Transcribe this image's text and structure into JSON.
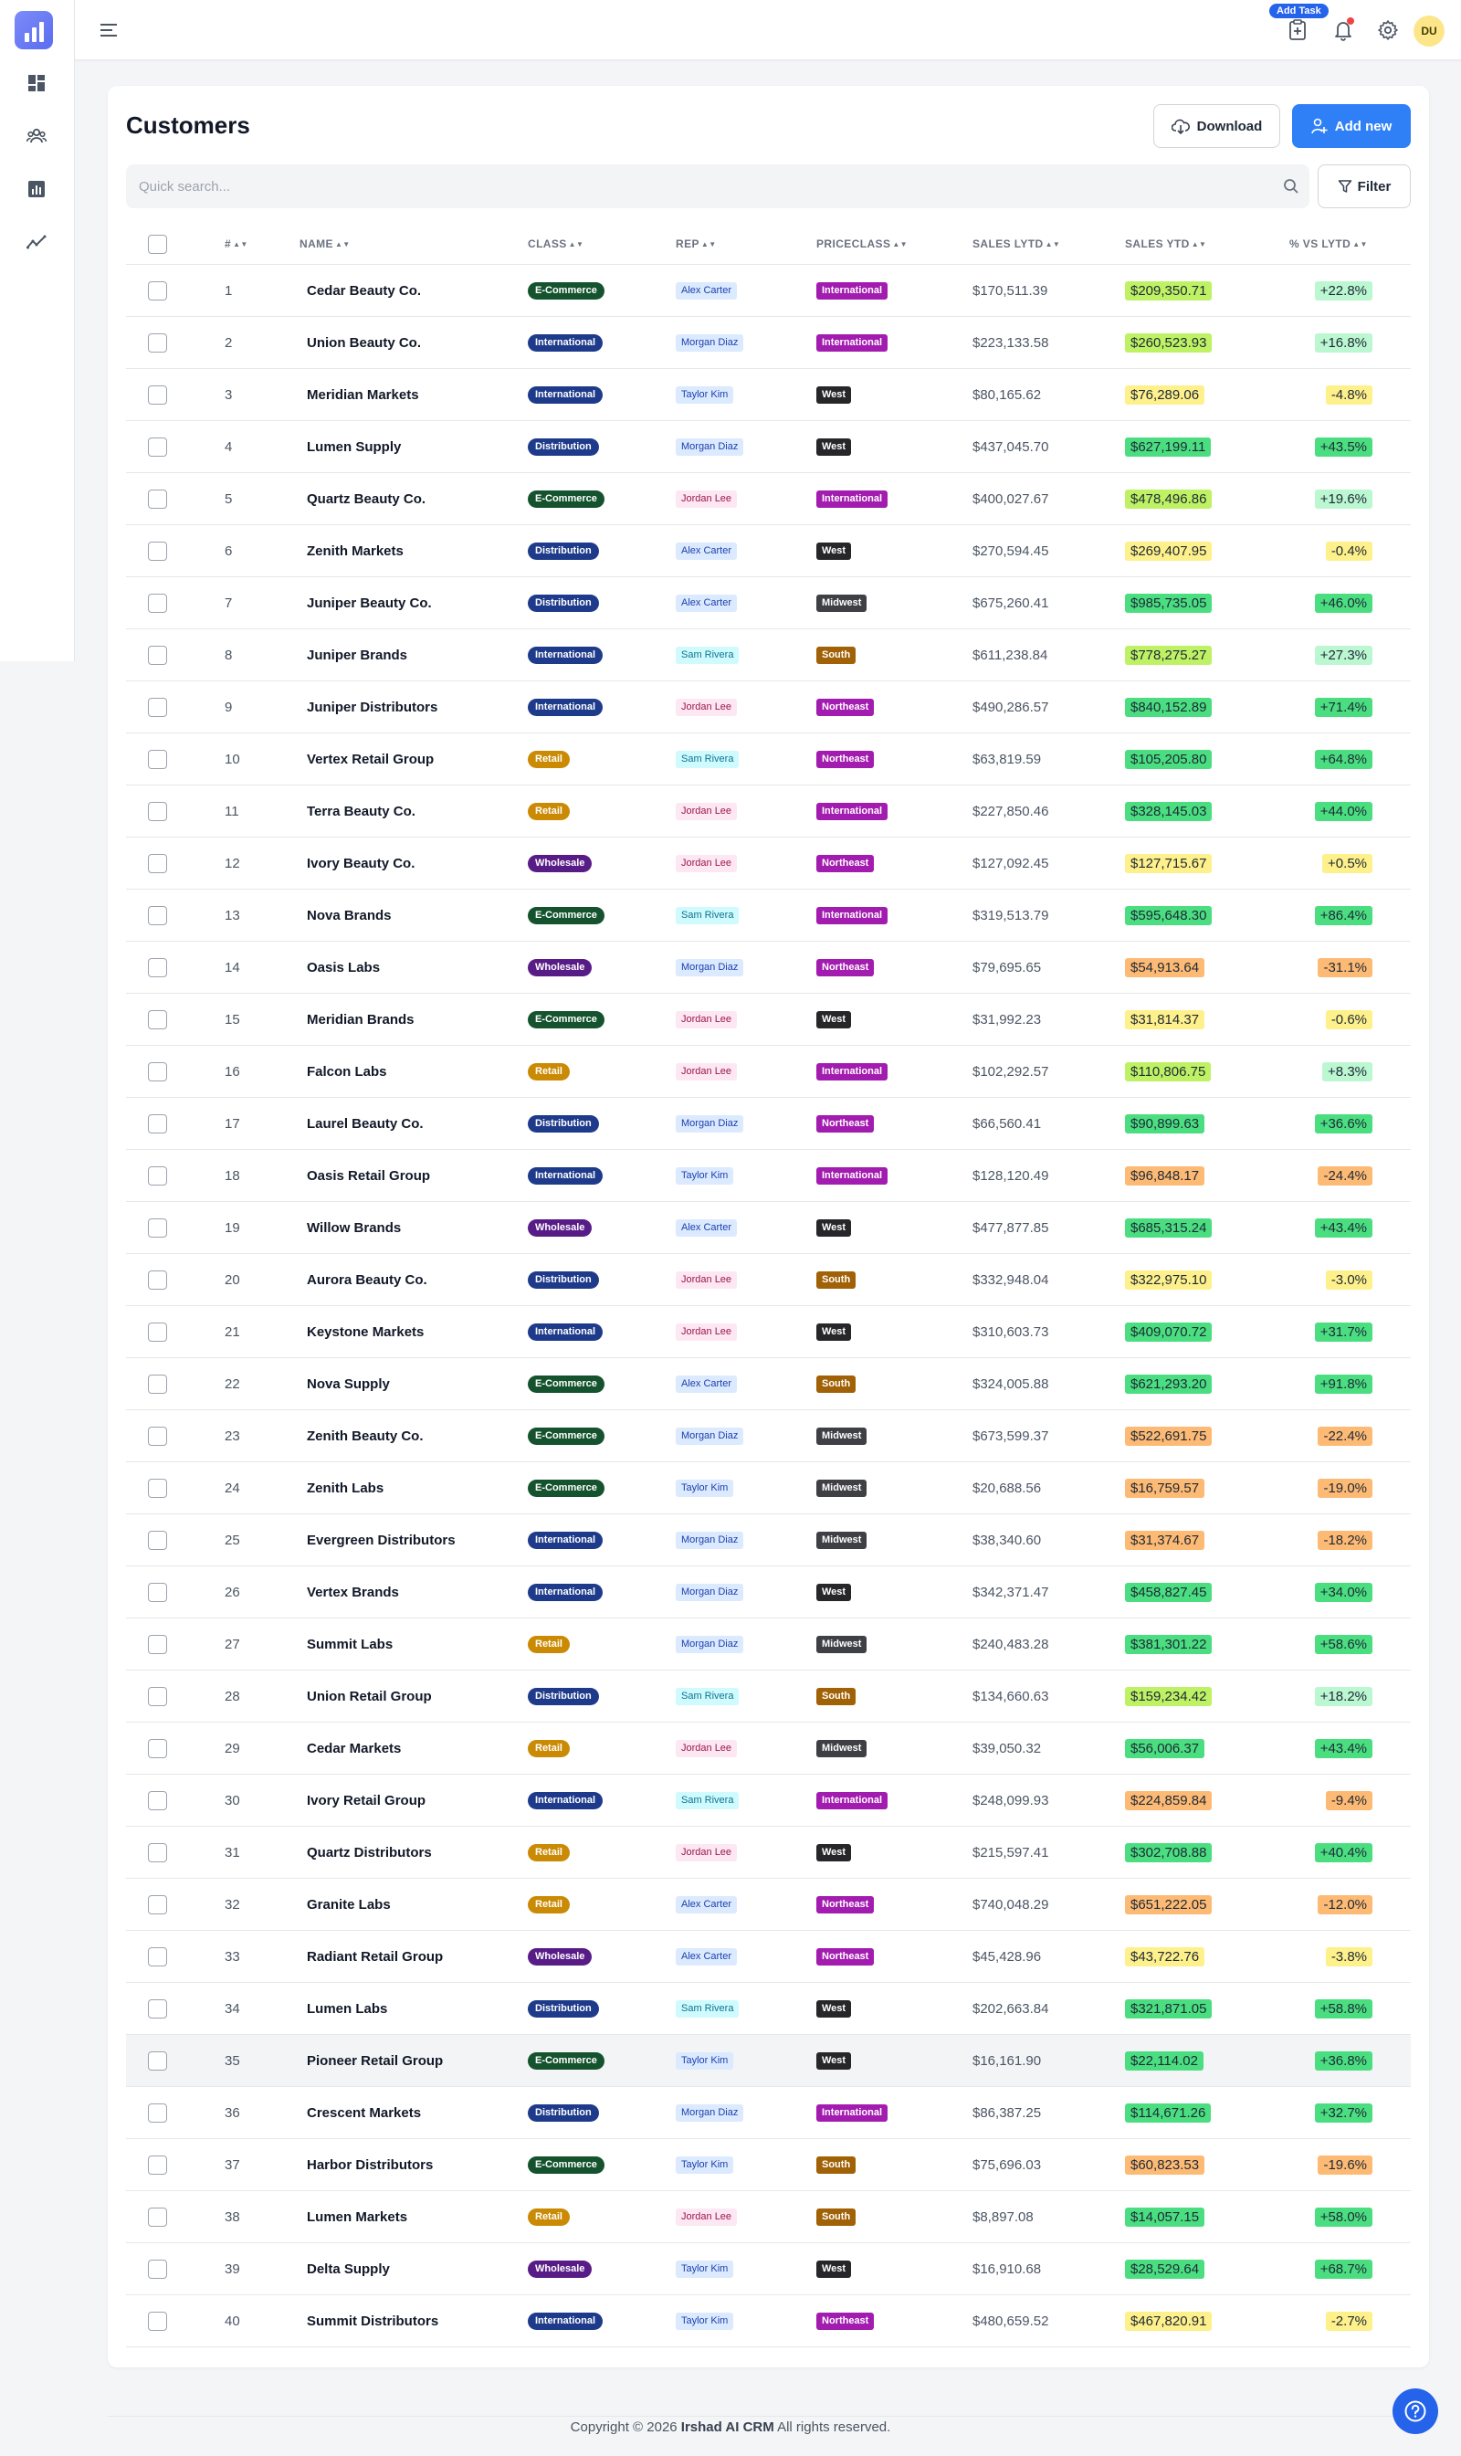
{
  "app": {
    "copyright_prefix": "Copyright © 2026",
    "brand": "Irshad AI CRM",
    "copyright_suffix": "All rights reserved."
  },
  "header": {
    "add_task_label": "Add Task",
    "avatar_initials": "DU"
  },
  "page": {
    "title": "Customers"
  },
  "toolbar": {
    "download_label": "Download",
    "add_new_label": "Add new",
    "filter_label": "Filter"
  },
  "search": {
    "placeholder": "Quick search..."
  },
  "table": {
    "columns": [
      "#",
      "NAME",
      "CLASS",
      "REP",
      "PRICECLASS",
      "SALES LYTD",
      "SALES YTD",
      "% VS LYTD"
    ],
    "highlighted_row": 35,
    "rows": [
      [
        "1",
        "Cedar Beauty Co.",
        "E-Commerce",
        "Alex Carter",
        "International",
        "$170,511.39",
        "$209,350.71",
        "+22.8%"
      ],
      [
        "2",
        "Union Beauty Co.",
        "International",
        "Morgan Diaz",
        "International",
        "$223,133.58",
        "$260,523.93",
        "+16.8%"
      ],
      [
        "3",
        "Meridian Markets",
        "International",
        "Taylor Kim",
        "West",
        "$80,165.62",
        "$76,289.06",
        "-4.8%"
      ],
      [
        "4",
        "Lumen Supply",
        "Distribution",
        "Morgan Diaz",
        "West",
        "$437,045.70",
        "$627,199.11",
        "+43.5%"
      ],
      [
        "5",
        "Quartz Beauty Co.",
        "E-Commerce",
        "Jordan Lee",
        "International",
        "$400,027.67",
        "$478,496.86",
        "+19.6%"
      ],
      [
        "6",
        "Zenith Markets",
        "Distribution",
        "Alex Carter",
        "West",
        "$270,594.45",
        "$269,407.95",
        "-0.4%"
      ],
      [
        "7",
        "Juniper Beauty Co.",
        "Distribution",
        "Alex Carter",
        "Midwest",
        "$675,260.41",
        "$985,735.05",
        "+46.0%"
      ],
      [
        "8",
        "Juniper Brands",
        "International",
        "Sam Rivera",
        "South",
        "$611,238.84",
        "$778,275.27",
        "+27.3%"
      ],
      [
        "9",
        "Juniper Distributors",
        "International",
        "Jordan Lee",
        "Northeast",
        "$490,286.57",
        "$840,152.89",
        "+71.4%"
      ],
      [
        "10",
        "Vertex Retail Group",
        "Retail",
        "Sam Rivera",
        "Northeast",
        "$63,819.59",
        "$105,205.80",
        "+64.8%"
      ],
      [
        "11",
        "Terra Beauty Co.",
        "Retail",
        "Jordan Lee",
        "International",
        "$227,850.46",
        "$328,145.03",
        "+44.0%"
      ],
      [
        "12",
        "Ivory Beauty Co.",
        "Wholesale",
        "Jordan Lee",
        "Northeast",
        "$127,092.45",
        "$127,715.67",
        "+0.5%"
      ],
      [
        "13",
        "Nova Brands",
        "E-Commerce",
        "Sam Rivera",
        "International",
        "$319,513.79",
        "$595,648.30",
        "+86.4%"
      ],
      [
        "14",
        "Oasis Labs",
        "Wholesale",
        "Morgan Diaz",
        "Northeast",
        "$79,695.65",
        "$54,913.64",
        "-31.1%"
      ],
      [
        "15",
        "Meridian Brands",
        "E-Commerce",
        "Jordan Lee",
        "West",
        "$31,992.23",
        "$31,814.37",
        "-0.6%"
      ],
      [
        "16",
        "Falcon Labs",
        "Retail",
        "Jordan Lee",
        "International",
        "$102,292.57",
        "$110,806.75",
        "+8.3%"
      ],
      [
        "17",
        "Laurel Beauty Co.",
        "Distribution",
        "Morgan Diaz",
        "Northeast",
        "$66,560.41",
        "$90,899.63",
        "+36.6%"
      ],
      [
        "18",
        "Oasis Retail Group",
        "International",
        "Taylor Kim",
        "International",
        "$128,120.49",
        "$96,848.17",
        "-24.4%"
      ],
      [
        "19",
        "Willow Brands",
        "Wholesale",
        "Alex Carter",
        "West",
        "$477,877.85",
        "$685,315.24",
        "+43.4%"
      ],
      [
        "20",
        "Aurora Beauty Co.",
        "Distribution",
        "Jordan Lee",
        "South",
        "$332,948.04",
        "$322,975.10",
        "-3.0%"
      ],
      [
        "21",
        "Keystone Markets",
        "International",
        "Jordan Lee",
        "West",
        "$310,603.73",
        "$409,070.72",
        "+31.7%"
      ],
      [
        "22",
        "Nova Supply",
        "E-Commerce",
        "Alex Carter",
        "South",
        "$324,005.88",
        "$621,293.20",
        "+91.8%"
      ],
      [
        "23",
        "Zenith Beauty Co.",
        "E-Commerce",
        "Morgan Diaz",
        "Midwest",
        "$673,599.37",
        "$522,691.75",
        "-22.4%"
      ],
      [
        "24",
        "Zenith Labs",
        "E-Commerce",
        "Taylor Kim",
        "Midwest",
        "$20,688.56",
        "$16,759.57",
        "-19.0%"
      ],
      [
        "25",
        "Evergreen Distributors",
        "International",
        "Morgan Diaz",
        "Midwest",
        "$38,340.60",
        "$31,374.67",
        "-18.2%"
      ],
      [
        "26",
        "Vertex Brands",
        "International",
        "Morgan Diaz",
        "West",
        "$342,371.47",
        "$458,827.45",
        "+34.0%"
      ],
      [
        "27",
        "Summit Labs",
        "Retail",
        "Morgan Diaz",
        "Midwest",
        "$240,483.28",
        "$381,301.22",
        "+58.6%"
      ],
      [
        "28",
        "Union Retail Group",
        "Distribution",
        "Sam Rivera",
        "South",
        "$134,660.63",
        "$159,234.42",
        "+18.2%"
      ],
      [
        "29",
        "Cedar Markets",
        "Retail",
        "Jordan Lee",
        "Midwest",
        "$39,050.32",
        "$56,006.37",
        "+43.4%"
      ],
      [
        "30",
        "Ivory Retail Group",
        "International",
        "Sam Rivera",
        "International",
        "$248,099.93",
        "$224,859.84",
        "-9.4%"
      ],
      [
        "31",
        "Quartz Distributors",
        "Retail",
        "Jordan Lee",
        "West",
        "$215,597.41",
        "$302,708.88",
        "+40.4%"
      ],
      [
        "32",
        "Granite Labs",
        "Retail",
        "Alex Carter",
        "Northeast",
        "$740,048.29",
        "$651,222.05",
        "-12.0%"
      ],
      [
        "33",
        "Radiant Retail Group",
        "Wholesale",
        "Alex Carter",
        "Northeast",
        "$45,428.96",
        "$43,722.76",
        "-3.8%"
      ],
      [
        "34",
        "Lumen Labs",
        "Distribution",
        "Sam Rivera",
        "West",
        "$202,663.84",
        "$321,871.05",
        "+58.8%"
      ],
      [
        "35",
        "Pioneer Retail Group",
        "E-Commerce",
        "Taylor Kim",
        "West",
        "$16,161.90",
        "$22,114.02",
        "+36.8%"
      ],
      [
        "36",
        "Crescent Markets",
        "Distribution",
        "Morgan Diaz",
        "International",
        "$86,387.25",
        "$114,671.26",
        "+32.7%"
      ],
      [
        "37",
        "Harbor Distributors",
        "E-Commerce",
        "Taylor Kim",
        "South",
        "$75,696.03",
        "$60,823.53",
        "-19.6%"
      ],
      [
        "38",
        "Lumen Markets",
        "Retail",
        "Jordan Lee",
        "South",
        "$8,897.08",
        "$14,057.15",
        "+58.0%"
      ],
      [
        "39",
        "Delta Supply",
        "Wholesale",
        "Taylor Kim",
        "West",
        "$16,910.68",
        "$28,529.64",
        "+68.7%"
      ],
      [
        "40",
        "Summit Distributors",
        "International",
        "Taylor Kim",
        "Northeast",
        "$480,659.52",
        "$467,820.91",
        "-2.7%"
      ]
    ]
  },
  "colors": {
    "class": {
      "E-Commerce": "#14532d",
      "International": "#1e3a8a",
      "Distribution": "#1e3a8a",
      "Retail": "#ca8a04",
      "Wholesale": "#581c87"
    },
    "rep_bg": {
      "Alex Carter": "#dbeafe",
      "Morgan Diaz": "#dbeafe",
      "Taylor Kim": "#dbeafe",
      "Jordan Lee": "#fce7f3",
      "Sam Rivera": "#cffafe"
    },
    "rep_fg": {
      "Alex Carter": "#1e40af",
      "Morgan Diaz": "#1e40af",
      "Taylor Kim": "#1e40af",
      "Jordan Lee": "#9d174d",
      "Sam Rivera": "#0e7490"
    },
    "price": {
      "International": "#a21caf",
      "West": "#27272a",
      "Midwest": "#3f3f46",
      "South": "#a16207",
      "Northeast": "#a21caf"
    },
    "ytd_strong": "#4ade80",
    "ytd_mid": "#bef264",
    "ytd_flat": "#fef08a",
    "ytd_down": "#fdba74",
    "pct_strong": "#4ade80",
    "pct_mid": "#bbf7d0",
    "pct_flat": "#fef08a",
    "pct_down": "#fdba74"
  }
}
